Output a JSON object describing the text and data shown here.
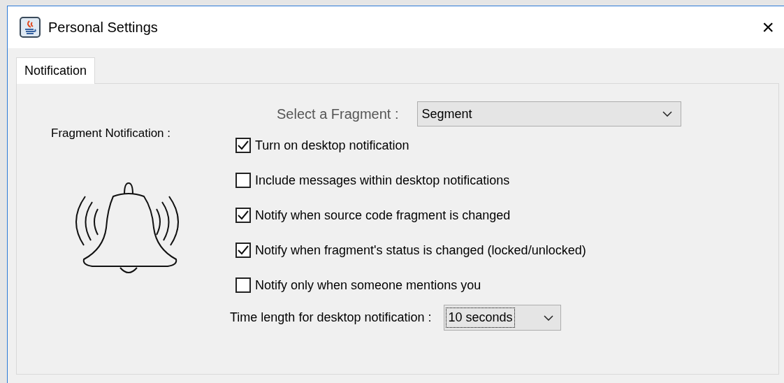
{
  "window": {
    "title": "Personal Settings",
    "close": "×"
  },
  "tabs": [
    {
      "label": "Notification",
      "selected": true
    }
  ],
  "fragment_select": {
    "label": "Select a Fragment :",
    "value": "Segment"
  },
  "section_label": "Fragment Notification :",
  "options": [
    {
      "label": "Turn on desktop notification",
      "checked": true
    },
    {
      "label": "Include messages within desktop notifications",
      "checked": false
    },
    {
      "label": "Notify when source code fragment is changed",
      "checked": true
    },
    {
      "label": "Notify when fragment's status is changed (locked/unlocked)",
      "checked": true
    },
    {
      "label": "Notify only when someone mentions you",
      "checked": false
    }
  ],
  "duration_select": {
    "label": "Time length for desktop notification :",
    "value": "10 seconds",
    "focused": true
  }
}
